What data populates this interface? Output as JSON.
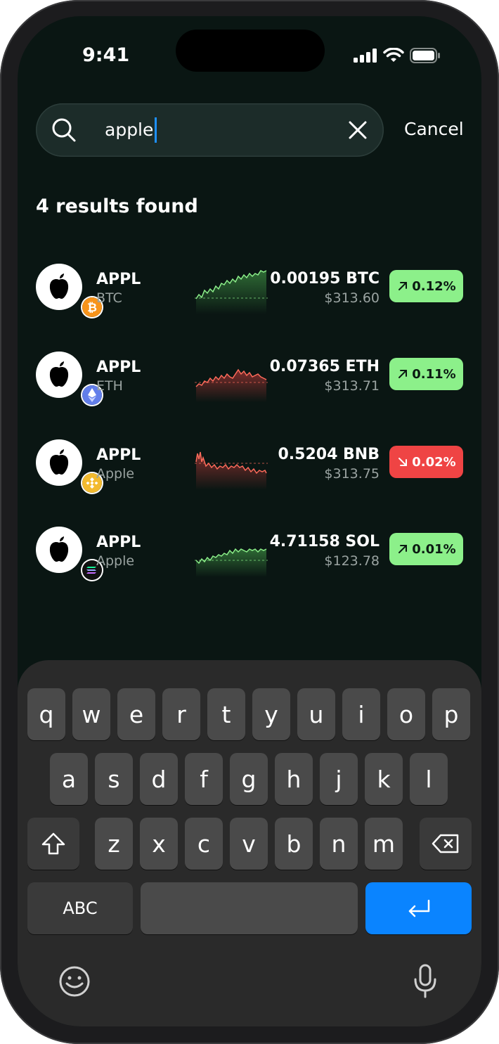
{
  "status_bar": {
    "time": "9:41"
  },
  "search": {
    "query": "apple",
    "cancel_label": "Cancel"
  },
  "results_title": "4 results found",
  "results": [
    {
      "ticker": "APPL",
      "sub": "BTC",
      "coin": "bitcoin-icon",
      "price": "0.00195 BTC",
      "usd": "$313.60",
      "change": "0.12%",
      "direction": "up"
    },
    {
      "ticker": "APPL",
      "sub": "ETH",
      "coin": "ethereum-icon",
      "price": "0.07365 ETH",
      "usd": "$313.71",
      "change": "0.11%",
      "direction": "up"
    },
    {
      "ticker": "APPL",
      "sub": "Apple",
      "coin": "bnb-icon",
      "price": "0.5204 BNB",
      "usd": "$313.75",
      "change": "0.02%",
      "direction": "down"
    },
    {
      "ticker": "APPL",
      "sub": "Apple",
      "coin": "solana-icon",
      "price": "4.71158 SOL",
      "usd": "$123.78",
      "change": "0.01%",
      "direction": "up"
    }
  ],
  "keyboard": {
    "row1": [
      "q",
      "w",
      "e",
      "r",
      "t",
      "y",
      "u",
      "i",
      "o",
      "p"
    ],
    "row2": [
      "a",
      "s",
      "d",
      "f",
      "g",
      "h",
      "j",
      "k",
      "l"
    ],
    "row3": [
      "z",
      "x",
      "c",
      "v",
      "b",
      "n",
      "m"
    ],
    "abc_label": "ABC"
  },
  "colors": {
    "up": "#8cf08a",
    "down": "#ef4444",
    "accent": "#0a84ff",
    "background": "#0a1613"
  }
}
